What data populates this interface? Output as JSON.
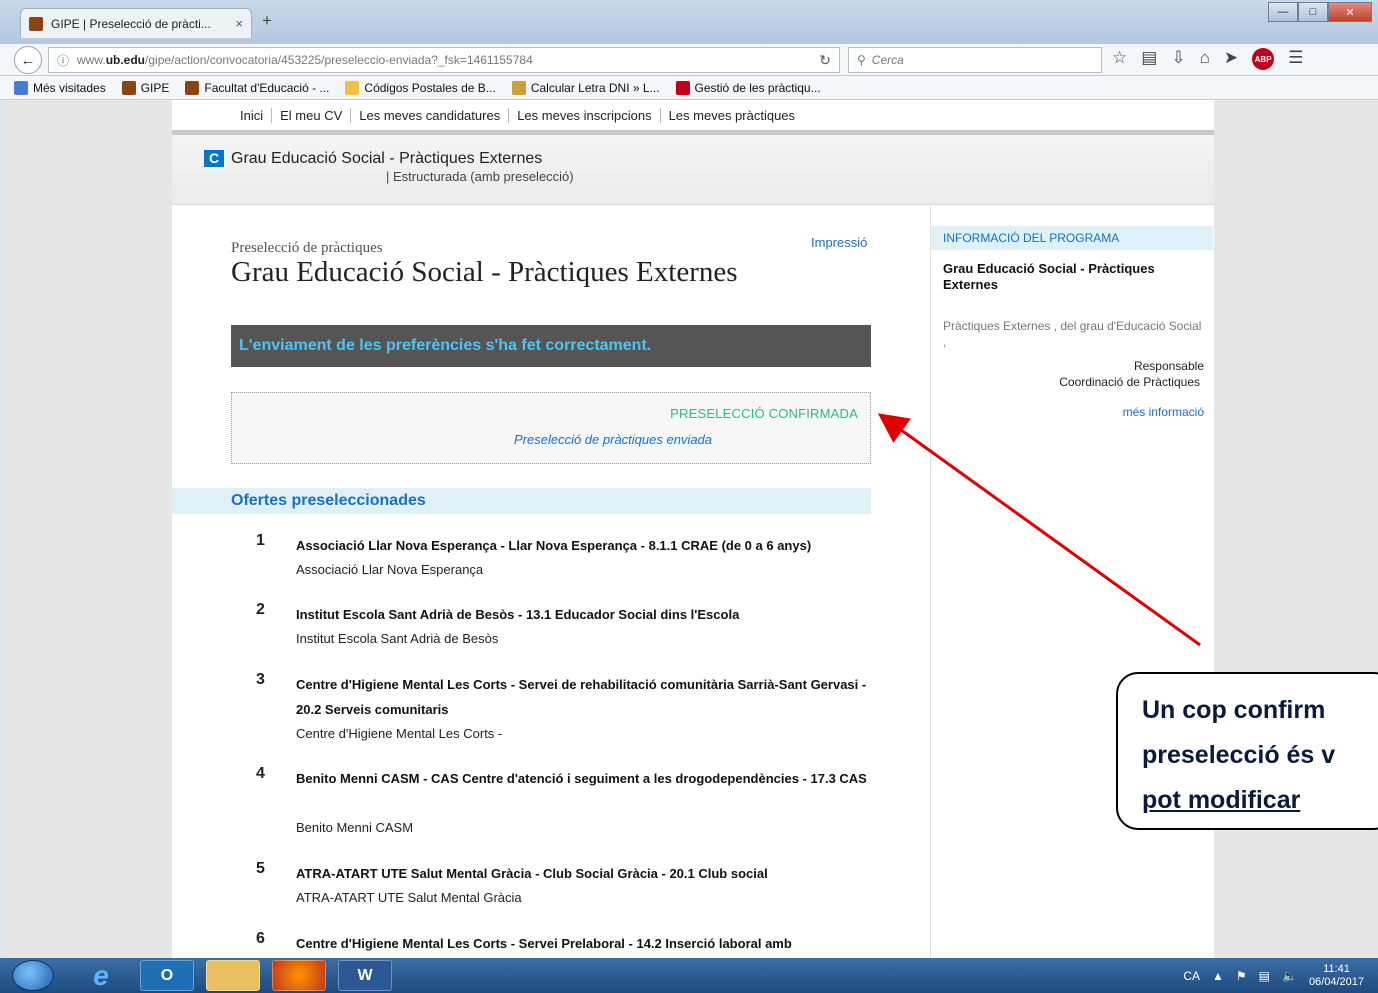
{
  "browser": {
    "tab_title": "GIPE | Preselecció de pràcti...",
    "tab_close": "×",
    "new_tab": "+",
    "url_prefix": "www.",
    "url_domain": "ub.edu",
    "url_path": "/gipe/action/convocatoria/453225/preseleccio-enviada?_fsk=1461155784",
    "search_placeholder": "Cerca"
  },
  "bookmarks": [
    {
      "label": "Més visitades",
      "color": "#4a7bd0"
    },
    {
      "label": "GIPE",
      "color": "#8b4513"
    },
    {
      "label": "Facultat d'Educació - ...",
      "color": "#8b4513"
    },
    {
      "label": "Códigos Postales de B...",
      "color": "#f0c040"
    },
    {
      "label": "Calcular Letra DNI » L...",
      "color": "#c7a23a"
    },
    {
      "label": "Gestió de les pràctiqu...",
      "color": "#c0001a"
    }
  ],
  "topnav": [
    "Inici",
    "El meu CV",
    "Les meves candidatures",
    "Les meves inscripcions",
    "Les meves pràctiques"
  ],
  "banner": {
    "badge": "C",
    "title": "Grau Educació Social - Pràctiques Externes",
    "subtitle": "| Estructurada (amb preselecció)"
  },
  "main": {
    "breadcrumb": "Preselecció de pràctiques",
    "print_link": "Impressió",
    "title": "Grau Educació Social - Pràctiques Externes",
    "success_message": "L'enviament de les preferències s'ha fet correctament.",
    "confirm_status": "PRESELECCIÓ CONFIRMADA",
    "confirm_link": "Preselecció de pràctiques enviada",
    "section_title": "Ofertes preseleccionades"
  },
  "offers": [
    {
      "num": "1",
      "title": "Associació Llar Nova Esperança - Llar Nova Esperança - 8.1.1 CRAE (de 0 a 6 anys)",
      "entity": "Associació Llar Nova Esperança"
    },
    {
      "num": "2",
      "title": "Institut Escola Sant Adrià de Besòs - 13.1 Educador Social dins l'Escola",
      "entity": "Institut Escola Sant Adrià de Besòs"
    },
    {
      "num": "3",
      "title": "Centre d'Higiene Mental Les Corts - Servei de rehabilitació comunitària Sarrià-Sant Gervasi - 20.2 Serveis comunitaris",
      "entity": "Centre d'Higiene Mental Les Corts -"
    },
    {
      "num": "4",
      "title": "Benito Menni CASM - CAS Centre d'atenció i seguiment a les drogodependències - 17.3 CAS",
      "entity": "Benito Menni CASM"
    },
    {
      "num": "5",
      "title": "ATRA-ATART UTE Salut Mental Gràcia - Club Social Gràcia - 20.1 Club social",
      "entity": "ATRA-ATART UTE Salut Mental Gràcia"
    },
    {
      "num": "6",
      "title": "Centre d'Higiene Mental Les Corts - Servei Prelaboral - 14.2 Inserció laboral amb",
      "entity": ""
    }
  ],
  "sidebar": {
    "heading": "INFORMACIÓ DEL PROGRAMA",
    "title": "Grau Educació Social - Pràctiques Externes",
    "description": "Pràctiques Externes    , del grau d'Educació Social ,",
    "resp_label": "Responsable",
    "resp_value": "Coordinació de Pràctiques",
    "more_link": "més informació"
  },
  "annotation": {
    "line1": "Un cop confirm",
    "line2": "preselecció és v",
    "line3": "pot modificar",
    "arrow_color": "#e00000"
  },
  "taskbar": {
    "lang": "CA",
    "time": "11:41",
    "date": "06/04/2017"
  }
}
